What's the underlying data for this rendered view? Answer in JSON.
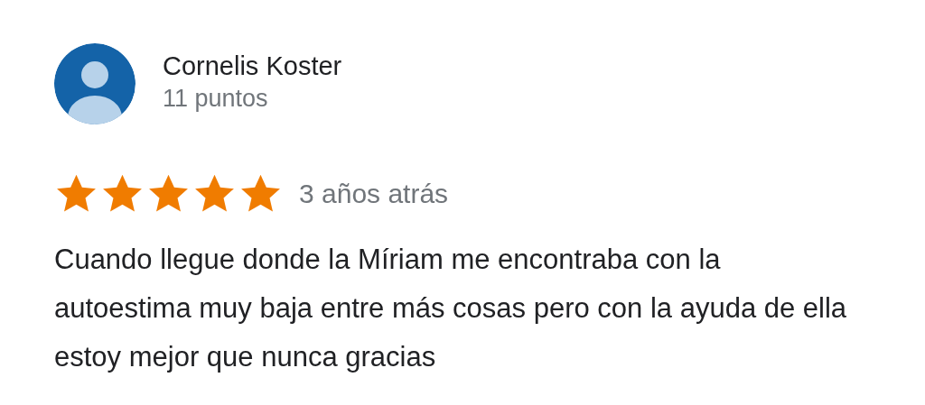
{
  "review": {
    "author": "Cornelis Koster",
    "points": "11 puntos",
    "stars": 5,
    "time": "3 años atrás",
    "text": "Cuando llegue donde la Míriam me encontraba con la autoestima muy baja entre más cosas pero con la ayuda de ella estoy mejor que nunca gracias"
  }
}
